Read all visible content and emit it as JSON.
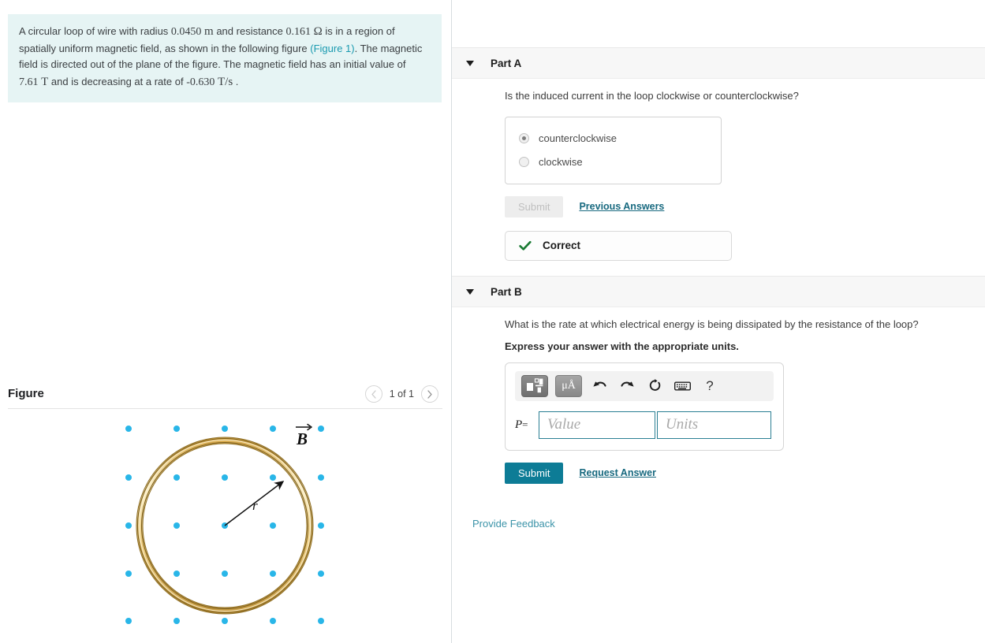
{
  "problem": {
    "text_part1": "A circular loop of wire with radius ",
    "radius_value": "0.0450",
    "radius_unit": "m",
    "text_part2": " and resistance ",
    "resistance_value": "0.161",
    "resistance_unit": "Ω",
    "text_part3": " is in a region of spatially uniform magnetic field, as shown in the following figure ",
    "figure_link": "(Figure 1)",
    "text_part4": ". The magnetic field is directed out of the plane of the figure. The magnetic field has an initial value of ",
    "field_value": "7.61",
    "field_unit": "T",
    "text_part5": " and is decreasing at a rate of ",
    "rate_value": "-0.630",
    "rate_unit": "T/s",
    "text_part6": " ."
  },
  "figure": {
    "title": "Figure",
    "counter": "1 of 1",
    "prev_icon": "chevron-left-icon",
    "next_icon": "chevron-right-icon",
    "loop_label": "r",
    "field_label": "B",
    "loop_color": "#e8c87a",
    "loop_edge_color": "#8a6a20",
    "dot_color": "#29b6e8",
    "dot_rows": 5,
    "dot_cols": 5
  },
  "part_a": {
    "header_label": "Part A",
    "caret_icon": "caret-down-icon",
    "question": "Is the induced current in the loop clockwise or counterclockwise?",
    "options": [
      {
        "label": "counterclockwise",
        "selected": true
      },
      {
        "label": "clockwise",
        "selected": false
      }
    ],
    "submit_label": "Submit",
    "submit_disabled": true,
    "previous_answers_label": "Previous Answers",
    "status_label": "Correct",
    "status_icon": "check-icon",
    "status_color": "#1a7a33"
  },
  "part_b": {
    "header_label": "Part B",
    "caret_icon": "caret-down-icon",
    "question": "What is the rate at which electrical energy is being dissipated by the resistance of the loop?",
    "instruction": "Express your answer with the appropriate units.",
    "toolbar": [
      {
        "name": "math-template-icon",
        "label": ""
      },
      {
        "name": "units-icon",
        "label": "μÅ"
      },
      {
        "name": "undo-icon",
        "label": ""
      },
      {
        "name": "redo-icon",
        "label": ""
      },
      {
        "name": "reset-icon",
        "label": ""
      },
      {
        "name": "keyboard-icon",
        "label": ""
      },
      {
        "name": "help-icon",
        "label": "?"
      }
    ],
    "variable_symbol": "P",
    "equals_symbol": "=",
    "value_placeholder": "Value",
    "value_text": "",
    "units_placeholder": "Units",
    "units_text": "",
    "submit_label": "Submit",
    "request_answer_label": "Request Answer"
  },
  "footer": {
    "feedback_label": "Provide Feedback"
  },
  "colors": {
    "accent_teal": "#0d7c96",
    "link_teal": "#17697f",
    "problem_bg": "#e6f4f4",
    "header_bg": "#f7f7f7"
  }
}
